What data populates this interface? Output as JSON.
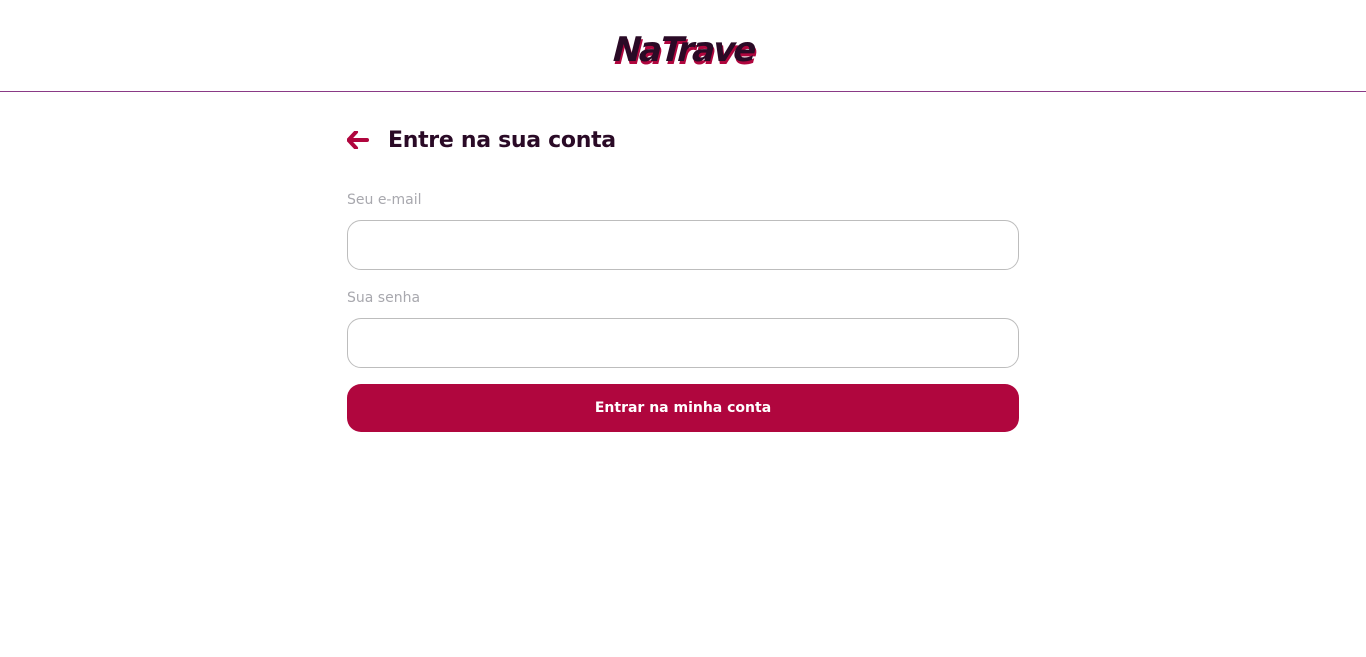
{
  "header": {
    "logo_text": "NaTrave"
  },
  "login": {
    "title": "Entre na sua conta",
    "email_label": "Seu e-mail",
    "email_value": "",
    "password_label": "Sua senha",
    "password_value": "",
    "submit_label": "Entrar na minha conta"
  },
  "colors": {
    "brand": "#b0063e",
    "logo_dark": "#2a0a26",
    "divider": "#8a3a86"
  },
  "icons": {
    "back": "arrow-left-icon"
  }
}
